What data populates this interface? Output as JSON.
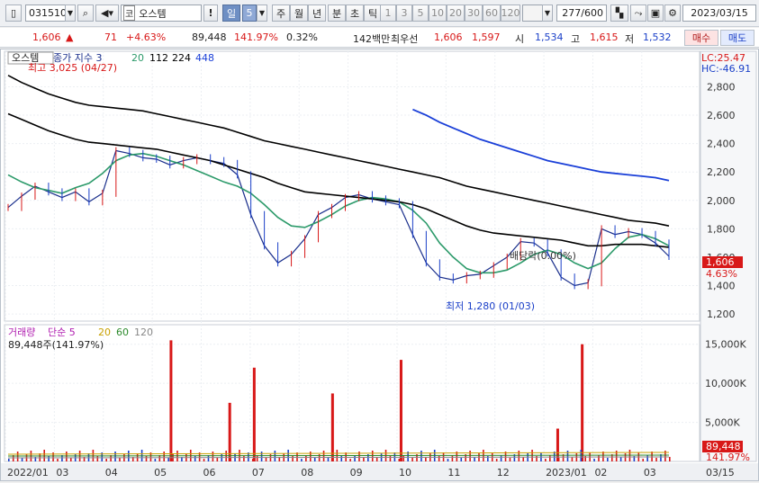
{
  "toolbar": {
    "code": "031510",
    "market_badge": "코",
    "name": "오스템",
    "period_day": "일",
    "period_num": "5",
    "periods": [
      "주",
      "월",
      "년",
      "분",
      "초",
      "틱"
    ],
    "nums": [
      "1",
      "3",
      "5",
      "10",
      "20",
      "30",
      "60",
      "120"
    ],
    "count": "277/600",
    "date": "2023/03/15"
  },
  "info": {
    "price": "1,606",
    "arrow": "▲",
    "change": "71",
    "change_pct": "+4.63%",
    "volume": "89,448",
    "vol_ratio": "141.97%",
    "turnover": "0.32%",
    "amount": "142백만",
    "best_label": "최우선",
    "ask": "1,606",
    "bid": "1,597",
    "open_label": "시",
    "open": "1,534",
    "high_label": "고",
    "high": "1,615",
    "low_label": "저",
    "low": "1,532",
    "buy_label": "매수",
    "sell_label": "매도"
  },
  "colors": {
    "up": "#d81818",
    "down": "#1a3fc8",
    "ma5": "#1a2f8c",
    "ma20": "#2c9a6a",
    "ma112": "#000000",
    "ma224": "#000000",
    "ma448": "#1a3fd8",
    "vol_ma5": "#b01eb0",
    "vol_ma20": "#c8a000",
    "vol_ma60": "#2c8a2c",
    "vol_ma120": "#888888"
  },
  "chart_data": [
    {
      "type": "line",
      "title": "오스템",
      "legend": [
        "종가 지수 3",
        "20",
        "112",
        "224",
        "448"
      ],
      "lc": "LC:25.47",
      "hc": "HC:-46.91",
      "annotations": {
        "high": "최고 3,025 (04/27)",
        "low": "최저 1,280 (01/03)",
        "dividend": "배당락(0.00%)",
        "price_tag": "1,606",
        "pct_tag": "4.63%"
      },
      "ylim": [
        1150,
        3050
      ],
      "yticks": [
        "1,200",
        "1,400",
        "1,600",
        "1,800",
        "2,000",
        "2,200",
        "2,400",
        "2,600",
        "2,800"
      ],
      "x_months": [
        "2022/01",
        "03",
        "04",
        "05",
        "06",
        "07",
        "08",
        "09",
        "10",
        "11",
        "12",
        "2023/01",
        "02",
        "03",
        "03/15"
      ],
      "series": [
        {
          "name": "종가",
          "values": [
            1950,
            2030,
            2100,
            2060,
            2020,
            2060,
            1990,
            2050,
            2350,
            2330,
            2300,
            2290,
            2250,
            2280,
            2300,
            2280,
            2260,
            2180,
            1900,
            1680,
            1560,
            1620,
            1730,
            1900,
            1950,
            2020,
            2040,
            2010,
            1990,
            1970,
            1760,
            1560,
            1460,
            1440,
            1470,
            1480,
            1540,
            1600,
            1710,
            1700,
            1630,
            1460,
            1400,
            1420,
            1800,
            1760,
            1780,
            1760,
            1700,
            1606
          ]
        },
        {
          "name": "20",
          "values": [
            2180,
            2130,
            2090,
            2070,
            2050,
            2090,
            2120,
            2190,
            2280,
            2320,
            2330,
            2310,
            2280,
            2250,
            2210,
            2170,
            2130,
            2100,
            2050,
            1970,
            1880,
            1820,
            1810,
            1850,
            1900,
            1960,
            2000,
            2020,
            2010,
            1990,
            1930,
            1840,
            1700,
            1600,
            1520,
            1490,
            1490,
            1510,
            1560,
            1620,
            1650,
            1620,
            1560,
            1520,
            1560,
            1660,
            1740,
            1760,
            1730,
            1680
          ]
        },
        {
          "name": "112",
          "values": [
            2610,
            2570,
            2530,
            2490,
            2460,
            2430,
            2410,
            2400,
            2390,
            2380,
            2370,
            2360,
            2340,
            2320,
            2300,
            2280,
            2250,
            2220,
            2190,
            2160,
            2120,
            2090,
            2060,
            2050,
            2040,
            2030,
            2020,
            2010,
            2000,
            1990,
            1970,
            1940,
            1900,
            1860,
            1820,
            1790,
            1770,
            1760,
            1750,
            1740,
            1730,
            1720,
            1700,
            1680,
            1680,
            1690,
            1690,
            1690,
            1680,
            1670
          ]
        },
        {
          "name": "224",
          "values": [
            2880,
            2830,
            2790,
            2750,
            2720,
            2690,
            2670,
            2660,
            2650,
            2640,
            2630,
            2610,
            2590,
            2570,
            2550,
            2530,
            2510,
            2480,
            2450,
            2420,
            2400,
            2380,
            2360,
            2340,
            2320,
            2300,
            2280,
            2260,
            2240,
            2220,
            2200,
            2180,
            2160,
            2130,
            2100,
            2080,
            2060,
            2040,
            2020,
            2000,
            1980,
            1960,
            1940,
            1920,
            1900,
            1880,
            1860,
            1850,
            1840,
            1820
          ]
        },
        {
          "name": "448",
          "values": [
            null,
            null,
            null,
            null,
            null,
            null,
            null,
            null,
            null,
            null,
            null,
            null,
            null,
            null,
            null,
            null,
            null,
            null,
            null,
            null,
            null,
            null,
            null,
            null,
            null,
            null,
            null,
            null,
            null,
            null,
            2640,
            2600,
            2550,
            2510,
            2470,
            2430,
            2400,
            2370,
            2340,
            2310,
            2280,
            2260,
            2240,
            2220,
            2200,
            2190,
            2180,
            2170,
            2160,
            2140
          ]
        }
      ]
    },
    {
      "type": "bar",
      "title": "거래량",
      "legend": [
        "단순 5",
        "20",
        "60",
        "120"
      ],
      "vol_label": "89,448주(141.97%)",
      "ylim": [
        0,
        17500
      ],
      "yticks": [
        "5,000K",
        "10,000K",
        "15,000K"
      ],
      "tag_value": "89,448",
      "tag_pct": "141.97%",
      "spikes_k": [
        {
          "x": 3.3,
          "v": 15500
        },
        {
          "x": 4.5,
          "v": 7500
        },
        {
          "x": 5.0,
          "v": 12000
        },
        {
          "x": 6.6,
          "v": 8700
        },
        {
          "x": 8.0,
          "v": 13000
        },
        {
          "x": 11.2,
          "v": 4200
        },
        {
          "x": 11.7,
          "v": 15000
        }
      ]
    }
  ]
}
